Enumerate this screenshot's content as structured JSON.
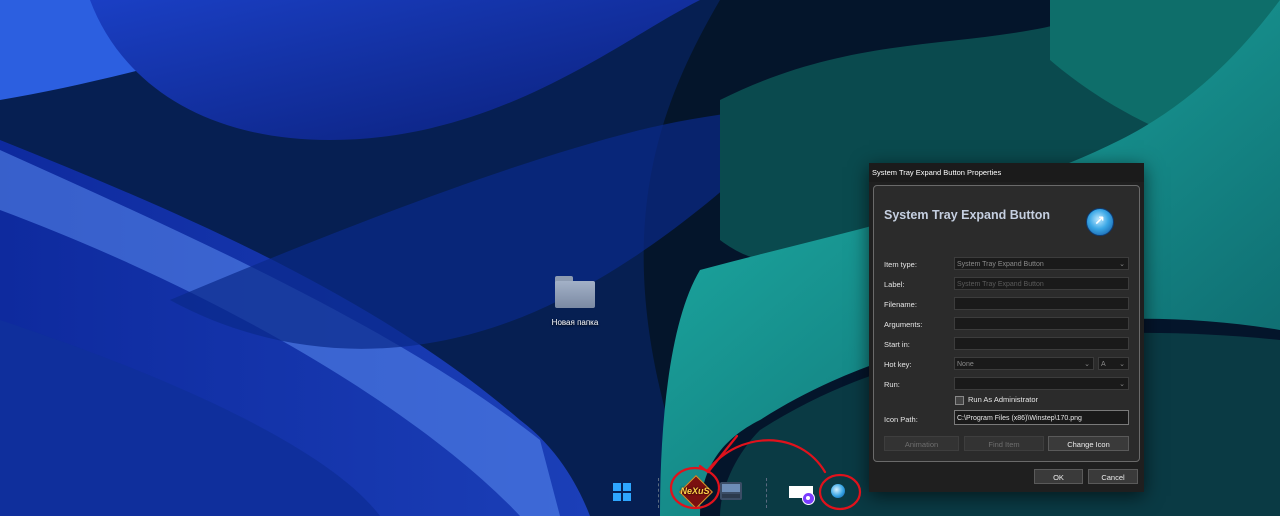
{
  "desktop": {
    "folder_label": "Новая папка"
  },
  "dialog": {
    "title": "System Tray Expand Button Properties",
    "heading": "System Tray Expand Button",
    "fields": {
      "item_type": {
        "label": "Item type:",
        "value": "System Tray Expand Button"
      },
      "label": {
        "label": "Label:",
        "value": "System Tray Expand Button"
      },
      "filename": {
        "label": "Filename:",
        "value": ""
      },
      "arguments": {
        "label": "Arguments:",
        "value": ""
      },
      "start_in": {
        "label": "Start in:",
        "value": ""
      },
      "hot_key": {
        "label": "Hot key:",
        "value": "None",
        "key_value": "A"
      },
      "run": {
        "label": "Run:",
        "value": ""
      },
      "icon_path": {
        "label": "Icon Path:",
        "value": "C:\\Program Files (x86)\\Winstep\\170.png"
      }
    },
    "run_as_admin_label": "Run As Administrator",
    "run_as_admin_checked": false,
    "buttons": {
      "animation": "Animation",
      "find_item": "Find Item",
      "change_icon": "Change Icon",
      "ok": "OK",
      "cancel": "Cancel"
    }
  },
  "taskbar": {
    "nexus_label": "NeXuS"
  },
  "colors": {
    "annotation": "#e0121c",
    "accent": "#2ea6ff",
    "dialog_bg": "#1f1f1f"
  }
}
